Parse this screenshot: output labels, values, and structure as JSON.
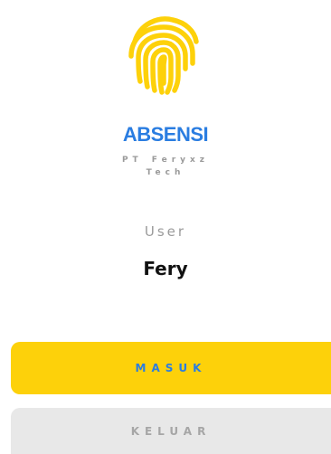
{
  "app": {
    "title": "ABSENSI",
    "company": "PT Feryxz Tech",
    "logo_icon": "fingerprint-icon"
  },
  "user": {
    "label": "User",
    "name": "Fery"
  },
  "actions": {
    "masuk_label": "MASUK",
    "keluar_label": "KELUAR"
  },
  "colors": {
    "accent_yellow": "#fdd10a",
    "brand_blue": "#2a7de1",
    "disabled_gray": "#e8e8e8"
  }
}
